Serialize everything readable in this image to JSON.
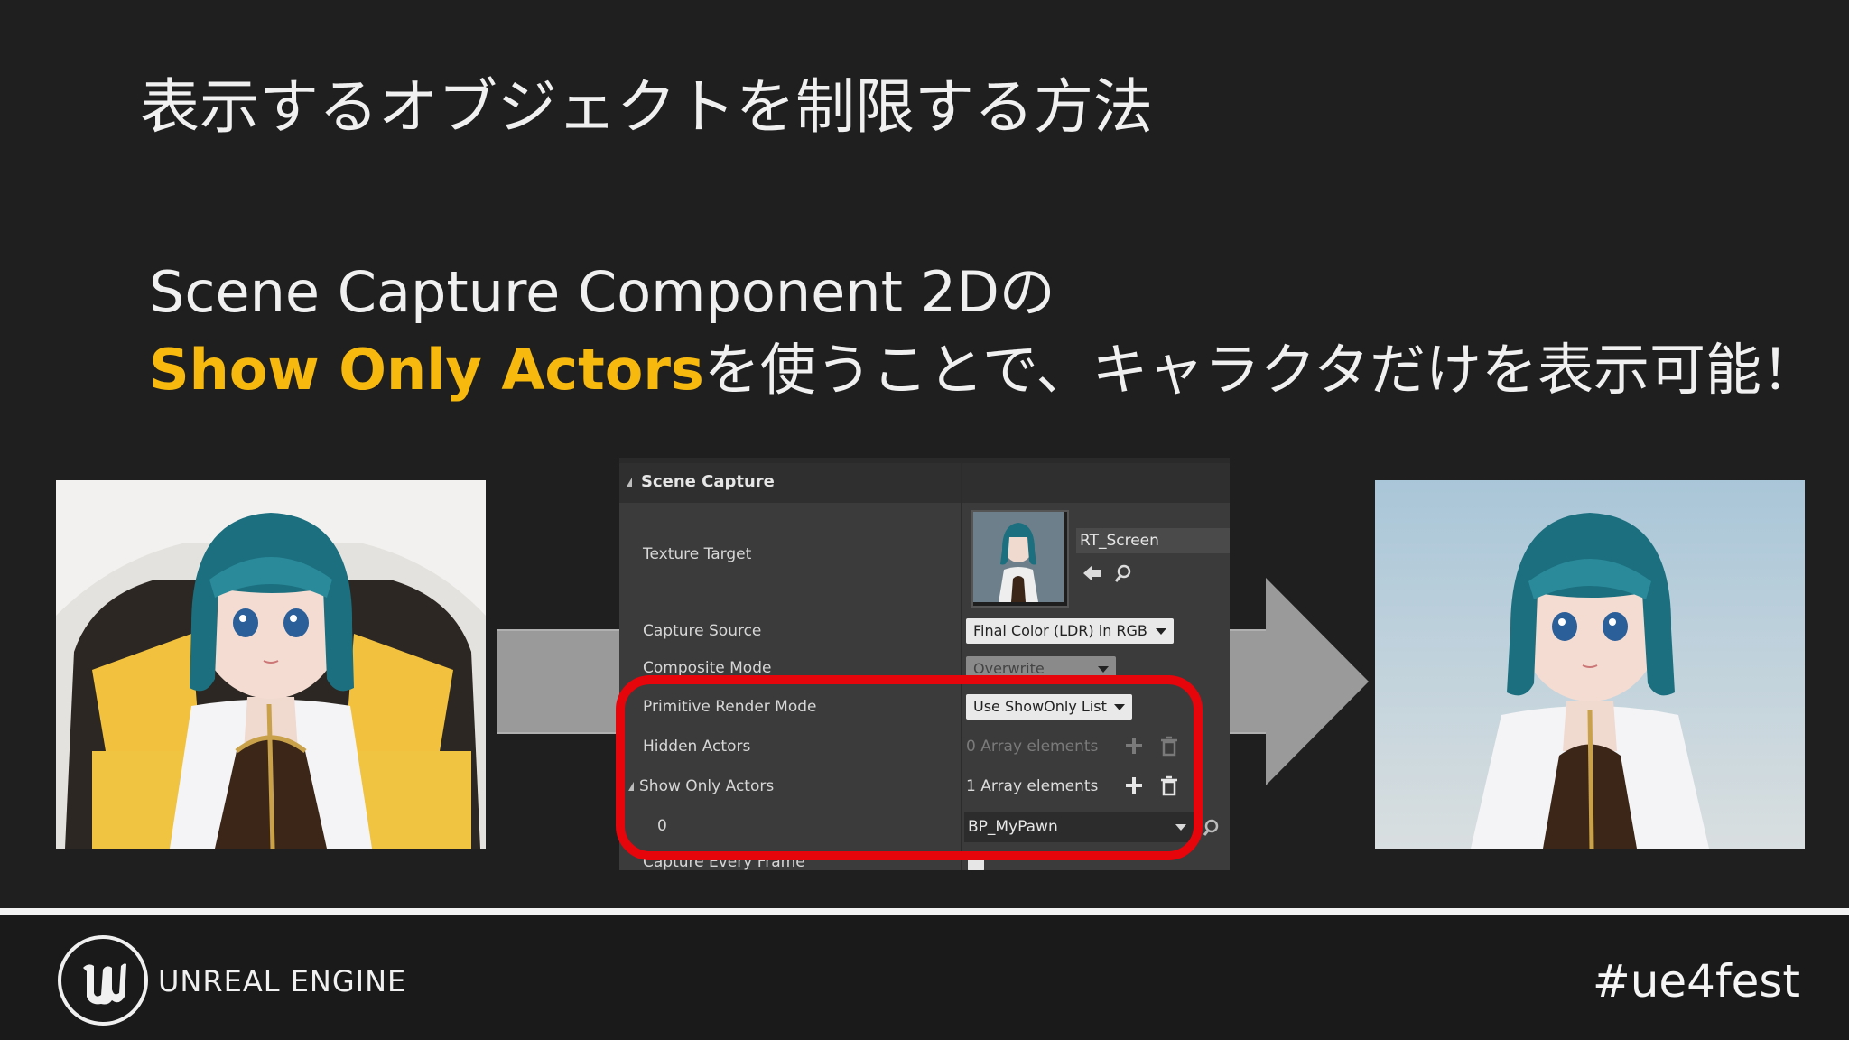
{
  "slide": {
    "title": "表示するオブジェクトを制限する方法",
    "line1": "Scene Capture Component 2Dの",
    "line2_highlight": "Show Only Actors",
    "line2_rest": "を使うことで、キャラクタだけを表示可能！"
  },
  "panel": {
    "section_title": "Scene Capture",
    "rows": {
      "texture_target": "Texture Target",
      "capture_source": "Capture Source",
      "composite_mode": "Composite Mode",
      "primitive_render_mode": "Primitive Render Mode",
      "hidden_actors": "Hidden Actors",
      "show_only_actors": "Show Only Actors",
      "index_0": "0",
      "capture_every_frame": "Capture Every Frame"
    },
    "values": {
      "texture_name": "RT_Screen",
      "capture_source": "Final Color (LDR) in RGB",
      "composite_mode": "Overwrite",
      "primitive_render_mode": "Use ShowOnly List",
      "hidden_actors_count": "0 Array elements",
      "show_only_actors_count": "1 Array elements",
      "show_only_item_0": "BP_MyPawn"
    }
  },
  "footer": {
    "brand": "UNREAL ENGINE",
    "hashtag": "#ue4fest"
  },
  "colors": {
    "background": "#1f1f1f",
    "highlight_text": "#f7b90e",
    "highlight_box": "#e5050b",
    "panel": "#3b3b3b"
  }
}
